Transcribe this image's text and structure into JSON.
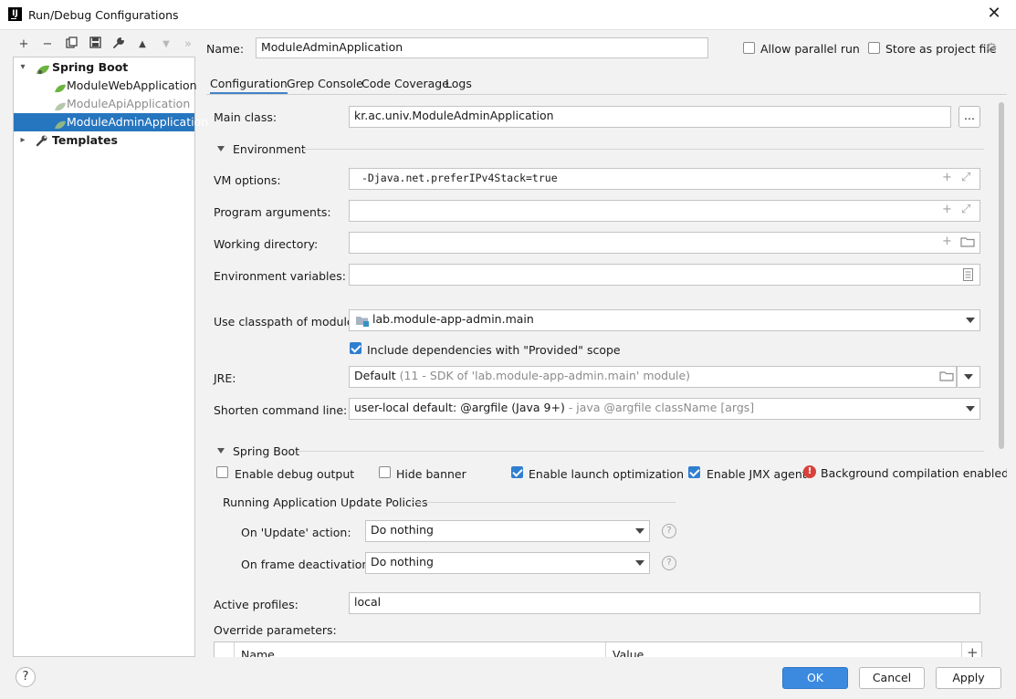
{
  "window": {
    "title": "Run/Debug Configurations",
    "app_icon_text": "IJ"
  },
  "toolbar": [
    {
      "name": "add-icon",
      "glyph": "+"
    },
    {
      "name": "remove-icon",
      "glyph": "−"
    },
    {
      "name": "copy-icon",
      "glyph": "⧉"
    },
    {
      "name": "save-icon",
      "glyph": "💾"
    },
    {
      "name": "wrench-icon",
      "glyph": "🔧"
    },
    {
      "name": "move-up-icon",
      "glyph": "▲"
    },
    {
      "name": "move-down-icon",
      "glyph": "▼"
    },
    {
      "name": "more-icon",
      "glyph": "»"
    }
  ],
  "tree": {
    "groups": [
      {
        "label": "Spring Boot"
      },
      {
        "label": "Templates"
      }
    ],
    "items": [
      {
        "label": "ModuleWebApplication"
      },
      {
        "label": "ModuleApiApplication"
      },
      {
        "label": "ModuleAdminApplication"
      }
    ]
  },
  "header": {
    "name_label": "Name:",
    "name_value": "ModuleAdminApplication",
    "allow_parallel": "Allow parallel run",
    "store_project": "Store as project file"
  },
  "tabs": [
    "Configuration",
    "Grep Console",
    "Code Coverage",
    "Logs"
  ],
  "config": {
    "main_class_label": "Main class:",
    "main_class_value": "kr.ac.univ.ModuleAdminApplication",
    "browse_label": "...",
    "environment_section": "Environment",
    "vm_options_label": "VM options:",
    "vm_options_value": "-Djava.net.preferIPv4Stack=true",
    "program_args_label": "Program arguments:",
    "working_dir_label": "Working directory:",
    "env_vars_label": "Environment variables:",
    "classpath_label": "Use classpath of module:",
    "classpath_value": "lab.module-app-admin.main",
    "include_deps": "Include dependencies with \"Provided\" scope",
    "jre_label": "JRE:",
    "jre_value": "Default",
    "jre_hint": "(11 - SDK of 'lab.module-app-admin.main' module)",
    "shorten_label": "Shorten command line:",
    "shorten_value": "user-local default: @argfile (Java 9+)",
    "shorten_hint": "- java @argfile className [args]"
  },
  "spring": {
    "section": "Spring Boot",
    "debug_output": "Enable debug output",
    "hide_banner": "Hide banner",
    "launch_opt": "Enable launch optimization",
    "jmx_agent": "Enable JMX agent",
    "bg_compile": "Background compilation enabled",
    "update_policies": "Running Application Update Policies",
    "on_update_label": "On 'Update' action:",
    "on_update_value": "Do nothing",
    "on_frame_label": "On frame deactivation:",
    "on_frame_value": "Do nothing",
    "active_profiles_label": "Active profiles:",
    "active_profiles_value": "local",
    "override_label": "Override parameters:",
    "col_name": "Name",
    "col_value": "Value",
    "add_glyph": "+"
  },
  "footer": {
    "ok": "OK",
    "cancel": "Cancel",
    "apply": "Apply",
    "help_glyph": "?"
  },
  "colors": {
    "selection": "#2675bf",
    "primary_button": "#3b8ae0",
    "checkbox_on": "#2f7fd0",
    "spring_leaf": "#6db33f",
    "error": "#d9423c"
  }
}
